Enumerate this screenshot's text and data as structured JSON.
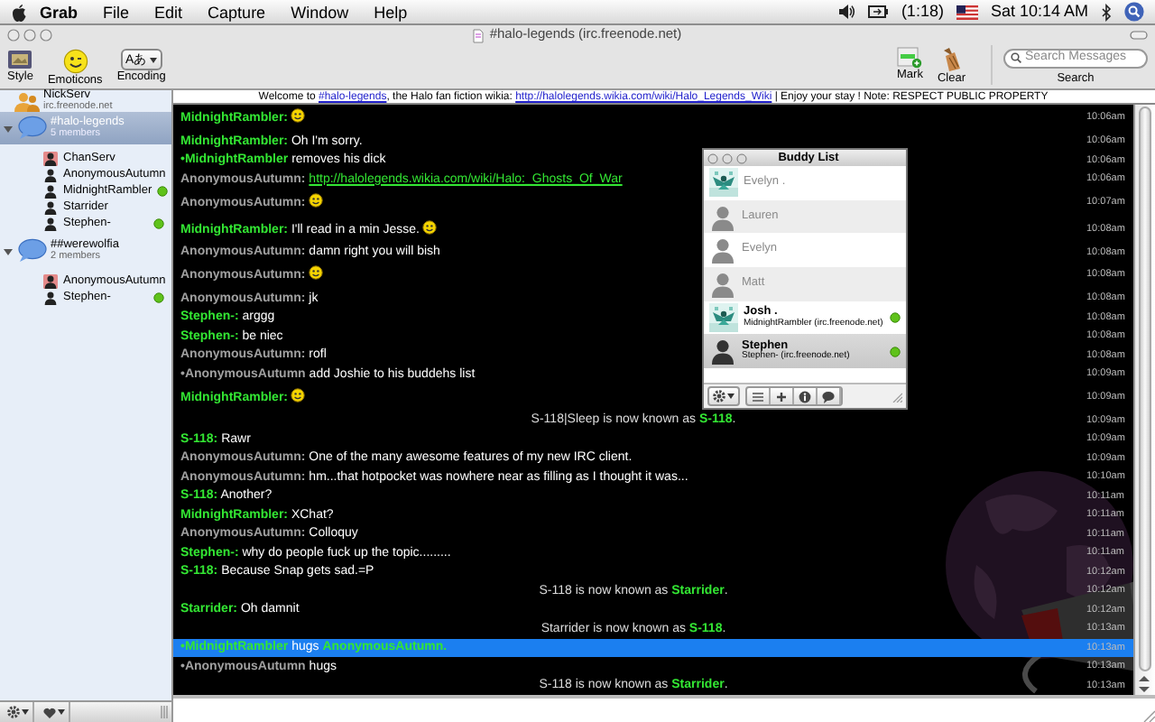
{
  "menu_bar": {
    "items": [
      "Grab",
      "File",
      "Edit",
      "Capture",
      "Window",
      "Help"
    ],
    "battery": "(1:18)",
    "clock": "Sat 10:14 AM"
  },
  "window": {
    "title": "#halo-legends (irc.freenode.net)"
  },
  "toolbar": {
    "left": [
      {
        "kind": "style",
        "label": "Style"
      },
      {
        "kind": "emoticons",
        "label": "Emoticons"
      },
      {
        "kind": "encoding",
        "label": "Encoding",
        "value": "Aあ"
      }
    ],
    "right": [
      {
        "kind": "mark",
        "label": "Mark"
      },
      {
        "kind": "clear",
        "label": "Clear"
      }
    ],
    "search": {
      "placeholder": "Search Messages",
      "label": "Search"
    }
  },
  "topic": [
    {
      "kind": "text",
      "text": "Welcome to "
    },
    {
      "kind": "link",
      "text": "#halo-legends"
    },
    {
      "kind": "text",
      "text": ", the Halo fan fiction wikia: "
    },
    {
      "kind": "link",
      "text": "http://halolegends.wikia.com/wiki/Halo_Legends_Wiki"
    },
    {
      "kind": "text",
      "text": " | Enjoy your stay ! Note: RESPECT PUBLIC PROPERTY"
    }
  ],
  "sidebar": {
    "items": [
      {
        "kind": "query",
        "name": "NickServ",
        "detail": "irc.freenode.net",
        "selected": false
      },
      {
        "kind": "channel",
        "name": "#halo-legends",
        "detail": "5 members",
        "selected": true,
        "expanded": true,
        "children": [
          {
            "name": "ChanServ",
            "operator": true,
            "online": false
          },
          {
            "name": "AnonymousAutumn",
            "operator": false,
            "online": false
          },
          {
            "name": "MidnightRambler",
            "operator": false,
            "online": true
          },
          {
            "name": "Starrider",
            "operator": false,
            "online": false
          },
          {
            "name": "Stephen-",
            "operator": false,
            "online": true
          }
        ]
      },
      {
        "kind": "channel",
        "name": "##werewolfia",
        "detail": "2 members",
        "selected": false,
        "expanded": true,
        "children": [
          {
            "name": "AnonymousAutumn",
            "operator": true,
            "online": false
          },
          {
            "name": "Stephen-",
            "operator": false,
            "online": true
          }
        ]
      }
    ]
  },
  "messages": [
    {
      "kind": "message",
      "time": "10:06am",
      "selected": false,
      "parts": [
        {
          "kind": "nick",
          "text": "MidnightRambler:",
          "color": "#33e633"
        },
        {
          "kind": "emoticon"
        }
      ]
    },
    {
      "kind": "message",
      "time": "10:06am",
      "selected": false,
      "parts": [
        {
          "kind": "nick",
          "text": "MidnightRambler:",
          "color": "#33e633"
        },
        {
          "kind": "text",
          "text": "Oh I'm sorry."
        }
      ]
    },
    {
      "kind": "message",
      "time": "10:06am",
      "selected": false,
      "parts": [
        {
          "kind": "nick",
          "text": "•MidnightRambler",
          "color": "#33e633"
        },
        {
          "kind": "text",
          "text": "removes his dick"
        }
      ]
    },
    {
      "kind": "message",
      "time": "10:06am",
      "selected": false,
      "parts": [
        {
          "kind": "nick",
          "text": "AnonymousAutumn:",
          "color": "#a0a0a0"
        },
        {
          "kind": "link",
          "text": "http://halolegends.wikia.com/wiki/Halo:_Ghosts_Of_War"
        }
      ]
    },
    {
      "kind": "message",
      "time": "10:07am",
      "selected": false,
      "parts": [
        {
          "kind": "nick",
          "text": "AnonymousAutumn:",
          "color": "#a0a0a0"
        },
        {
          "kind": "emoticon"
        }
      ]
    },
    {
      "kind": "message",
      "time": "10:08am",
      "selected": false,
      "parts": [
        {
          "kind": "nick",
          "text": "MidnightRambler:",
          "color": "#33e633"
        },
        {
          "kind": "text",
          "text": "I'll read in a min Jesse."
        },
        {
          "kind": "emoticon"
        }
      ]
    },
    {
      "kind": "message",
      "time": "10:08am",
      "selected": false,
      "parts": [
        {
          "kind": "nick",
          "text": "AnonymousAutumn:",
          "color": "#a0a0a0"
        },
        {
          "kind": "text",
          "text": "damn right you will bish"
        }
      ]
    },
    {
      "kind": "message",
      "time": "10:08am",
      "selected": false,
      "parts": [
        {
          "kind": "nick",
          "text": "AnonymousAutumn:",
          "color": "#a0a0a0"
        },
        {
          "kind": "emoticon"
        }
      ]
    },
    {
      "kind": "message",
      "time": "10:08am",
      "selected": false,
      "parts": [
        {
          "kind": "nick",
          "text": "AnonymousAutumn:",
          "color": "#a0a0a0"
        },
        {
          "kind": "text",
          "text": "jk"
        }
      ]
    },
    {
      "kind": "message",
      "time": "10:08am",
      "selected": false,
      "parts": [
        {
          "kind": "nick",
          "text": "Stephen-:",
          "color": "#33e633"
        },
        {
          "kind": "text",
          "text": "arggg"
        }
      ]
    },
    {
      "kind": "message",
      "time": "10:08am",
      "selected": false,
      "parts": [
        {
          "kind": "nick",
          "text": "Stephen-:",
          "color": "#33e633"
        },
        {
          "kind": "text",
          "text": "be niec"
        }
      ]
    },
    {
      "kind": "message",
      "time": "10:08am",
      "selected": false,
      "parts": [
        {
          "kind": "nick",
          "text": "AnonymousAutumn:",
          "color": "#a0a0a0"
        },
        {
          "kind": "text",
          "text": "rofl"
        }
      ]
    },
    {
      "kind": "message",
      "time": "10:09am",
      "selected": false,
      "parts": [
        {
          "kind": "nick",
          "text": "•AnonymousAutumn",
          "color": "#a0a0a0"
        },
        {
          "kind": "text",
          "text": "add Joshie to his buddehs list"
        }
      ]
    },
    {
      "kind": "message",
      "time": "10:09am",
      "selected": false,
      "parts": [
        {
          "kind": "nick",
          "text": "MidnightRambler:",
          "color": "#33e633"
        },
        {
          "kind": "emoticon"
        }
      ]
    },
    {
      "kind": "notice",
      "time": "10:09am",
      "selected": false,
      "parts": [
        {
          "kind": "text",
          "text": "S-118|Sleep is now known as"
        },
        {
          "kind": "nick",
          "text": "S-118",
          "color": "#33e633"
        },
        {
          "kind": "suffix",
          "text": "."
        }
      ]
    },
    {
      "kind": "message",
      "time": "10:09am",
      "selected": false,
      "parts": [
        {
          "kind": "nick",
          "text": "S-118:",
          "color": "#33e633"
        },
        {
          "kind": "text",
          "text": "Rawr"
        }
      ]
    },
    {
      "kind": "message",
      "time": "10:09am",
      "selected": false,
      "parts": [
        {
          "kind": "nick",
          "text": "AnonymousAutumn:",
          "color": "#a0a0a0"
        },
        {
          "kind": "text",
          "text": "One of the many awesome features of my new IRC client."
        }
      ]
    },
    {
      "kind": "message",
      "time": "10:10am",
      "selected": false,
      "parts": [
        {
          "kind": "nick",
          "text": "AnonymousAutumn:",
          "color": "#a0a0a0"
        },
        {
          "kind": "text",
          "text": "hm...that hotpocket was  nowhere near as filling as I thought it was..."
        }
      ]
    },
    {
      "kind": "message",
      "time": "10:11am",
      "selected": false,
      "parts": [
        {
          "kind": "nick",
          "text": "S-118:",
          "color": "#33e633"
        },
        {
          "kind": "text",
          "text": "Another?"
        }
      ]
    },
    {
      "kind": "message",
      "time": "10:11am",
      "selected": false,
      "parts": [
        {
          "kind": "nick",
          "text": "MidnightRambler:",
          "color": "#33e633"
        },
        {
          "kind": "text",
          "text": "XChat?"
        }
      ]
    },
    {
      "kind": "message",
      "time": "10:11am",
      "selected": false,
      "parts": [
        {
          "kind": "nick",
          "text": "AnonymousAutumn:",
          "color": "#a0a0a0"
        },
        {
          "kind": "text",
          "text": "Colloquy"
        }
      ]
    },
    {
      "kind": "message",
      "time": "10:11am",
      "selected": false,
      "parts": [
        {
          "kind": "nick",
          "text": "Stephen-:",
          "color": "#33e633"
        },
        {
          "kind": "text",
          "text": "why do people fuck up the topic........."
        }
      ]
    },
    {
      "kind": "message",
      "time": "10:12am",
      "selected": false,
      "parts": [
        {
          "kind": "nick",
          "text": "S-118:",
          "color": "#33e633"
        },
        {
          "kind": "text",
          "text": "Because Snap gets sad.=P"
        }
      ]
    },
    {
      "kind": "notice",
      "time": "10:12am",
      "selected": false,
      "parts": [
        {
          "kind": "text",
          "text": "S-118 is now known as"
        },
        {
          "kind": "nick",
          "text": "Starrider",
          "color": "#33e633"
        },
        {
          "kind": "suffix",
          "text": "."
        }
      ]
    },
    {
      "kind": "message",
      "time": "10:12am",
      "selected": false,
      "parts": [
        {
          "kind": "nick",
          "text": "Starrider:",
          "color": "#33e633"
        },
        {
          "kind": "text",
          "text": "Oh damnit"
        }
      ]
    },
    {
      "kind": "notice",
      "time": "10:13am",
      "selected": false,
      "parts": [
        {
          "kind": "text",
          "text": "Starrider is now known as"
        },
        {
          "kind": "nick",
          "text": "S-118",
          "color": "#33e633"
        },
        {
          "kind": "suffix",
          "text": "."
        }
      ]
    },
    {
      "kind": "message",
      "time": "10:13am",
      "selected": true,
      "parts": [
        {
          "kind": "nick",
          "text": "•MidnightRambler",
          "color": "#33e633"
        },
        {
          "kind": "text",
          "text": "hugs"
        },
        {
          "kind": "nick",
          "text": "AnonymousAutumn.",
          "color": "#33e633"
        }
      ]
    },
    {
      "kind": "message",
      "time": "10:13am",
      "selected": false,
      "parts": [
        {
          "kind": "nick",
          "text": "•AnonymousAutumn",
          "color": "#a0a0a0"
        },
        {
          "kind": "text",
          "text": "hugs"
        }
      ]
    },
    {
      "kind": "notice",
      "time": "10:13am",
      "selected": false,
      "parts": [
        {
          "kind": "text",
          "text": "S-118 is now known as"
        },
        {
          "kind": "nick",
          "text": "Starrider",
          "color": "#33e633"
        },
        {
          "kind": "suffix",
          "text": "."
        }
      ]
    }
  ],
  "buddy_list": {
    "title": "Buddy List",
    "buddies": [
      {
        "name": "Evelyn .",
        "kind": "picture",
        "online": false,
        "selected": false
      },
      {
        "name": "Lauren",
        "kind": "silhouette",
        "online": false,
        "selected": false
      },
      {
        "name": "Evelyn",
        "kind": "silhouette",
        "online": false,
        "selected": false
      },
      {
        "name": "Matt",
        "kind": "silhouette",
        "online": false,
        "selected": false
      },
      {
        "name": "Josh .",
        "detail": "MidnightRambler (irc.freenode.net)",
        "kind": "picture",
        "online": true,
        "selected": false
      },
      {
        "name": "Stephen",
        "detail": "Stephen- (irc.freenode.net)",
        "kind": "silhouette",
        "online": true,
        "selected": true
      }
    ]
  }
}
